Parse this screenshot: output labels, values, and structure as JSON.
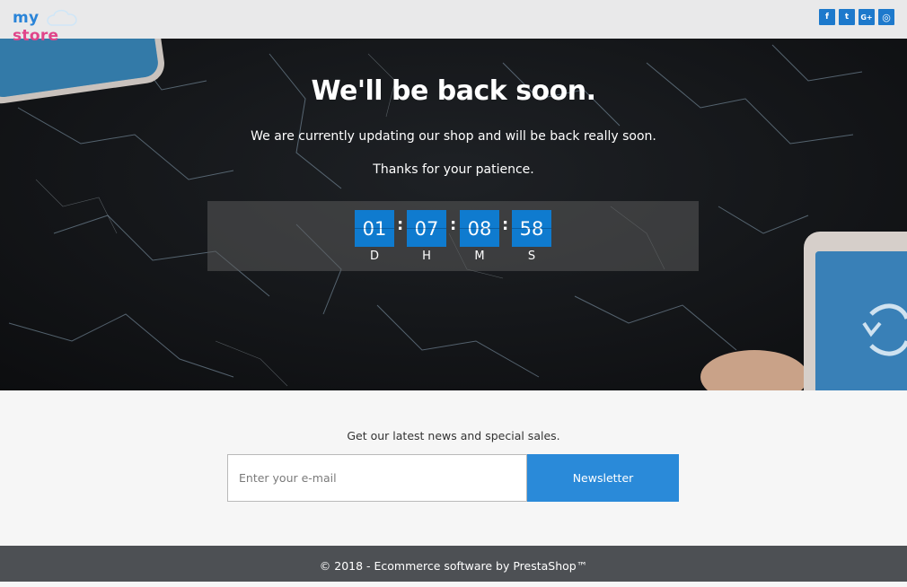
{
  "header": {
    "logo": {
      "part1": "my",
      "part2": "store"
    },
    "social": [
      {
        "name": "facebook",
        "glyph": "f"
      },
      {
        "name": "twitter",
        "glyph": "t"
      },
      {
        "name": "google-plus",
        "glyph": "G+"
      },
      {
        "name": "instagram",
        "glyph": "◎"
      }
    ]
  },
  "hero": {
    "title": "We'll be back soon.",
    "subtitle": "We are currently updating our shop and will be back really soon.",
    "thanks": "Thanks for your patience."
  },
  "countdown": {
    "days": "01",
    "hours": "07",
    "minutes": "08",
    "seconds": "58",
    "separator": ":",
    "labels": {
      "days": "D",
      "hours": "H",
      "minutes": "M",
      "seconds": "S"
    }
  },
  "newsletter": {
    "text": "Get our latest news and special sales.",
    "placeholder": "Enter your e-mail",
    "button": "Newsletter"
  },
  "footer": {
    "copyright": "© 2018 - Ecommerce software by PrestaShop™"
  },
  "colors": {
    "accent": "#1d79cc",
    "countdown": "#0f7bcf",
    "button": "#2a8ad9",
    "footer": "#4d5054"
  }
}
